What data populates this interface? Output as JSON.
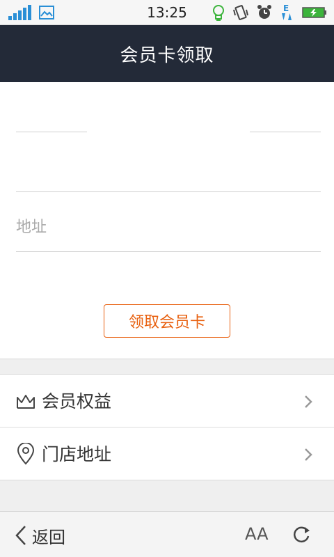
{
  "status_bar": {
    "time": "13:25",
    "icons": [
      "signal-icon",
      "image-icon",
      "bulb-icon",
      "vibrate-icon",
      "alarm-icon",
      "data-e-icon",
      "battery-icon"
    ]
  },
  "header": {
    "title": "会员卡领取"
  },
  "form": {
    "address_placeholder": "地址",
    "claim_button_label": "领取会员卡"
  },
  "menu": {
    "items": [
      {
        "label": "会员权益",
        "icon": "crown-icon"
      },
      {
        "label": "门店地址",
        "icon": "location-pin-icon"
      }
    ]
  },
  "bottom_bar": {
    "back_label": "返回",
    "font_size_label": "AA"
  },
  "colors": {
    "header_bg": "#232a38",
    "accent": "#e8600f",
    "status_icon_blue": "#2a8fd6",
    "status_icon_green": "#3cb43c"
  }
}
